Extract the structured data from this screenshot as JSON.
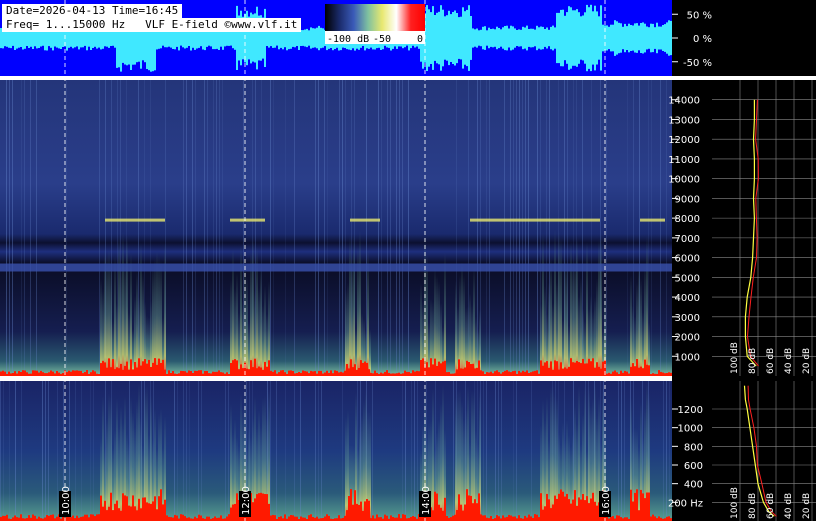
{
  "header": {
    "line1": "Date=2026-04-13 Time=16:45",
    "line2": "Freq= 1...15000 Hz   VLF E-field ©www.vlf.it"
  },
  "colorbar": {
    "labels": [
      "-100 dB",
      "-50",
      "0"
    ],
    "stops": [
      "#000000",
      "#1a2a6a",
      "#3a5ab8",
      "#7ec0a0",
      "#e8e870",
      "#ffffff",
      "#ff2020",
      "#ff0000"
    ]
  },
  "colors": {
    "waveform_bg": "#0000ff",
    "waveform_fg": "#40e8ff",
    "spec_dark": "#0a0f2a",
    "spec_mid": "#1e3278",
    "spec_bright": "#ff1a00",
    "grid": "#ffffff",
    "panel_bg": "#000000",
    "trace_yellow": "#ffff40",
    "trace_red": "#ff2020"
  },
  "chart_data": [
    {
      "type": "area",
      "panel": "waveform",
      "y_tick_labels": [
        "50 %",
        "0 %",
        "-50 %"
      ],
      "y_values": [
        50,
        0,
        -50
      ],
      "ylim": [
        -80,
        80
      ]
    },
    {
      "type": "heatmap",
      "panel": "spectrogram-full",
      "y_tick_labels": [
        "14000",
        "13000",
        "12000",
        "11000",
        "10000",
        "9000",
        "8000",
        "7000",
        "6000",
        "5000",
        "4000",
        "3000",
        "2000",
        "1000"
      ],
      "y_values": [
        14000,
        13000,
        12000,
        11000,
        10000,
        9000,
        8000,
        7000,
        6000,
        5000,
        4000,
        3000,
        2000,
        1000
      ],
      "ylim": [
        0,
        15000
      ],
      "x_time_marks": [
        "10:00",
        "12:00",
        "14:00",
        "16:00"
      ],
      "grid": true
    },
    {
      "type": "heatmap",
      "panel": "spectrogram-low",
      "y_tick_labels": [
        "1200",
        "1000",
        "800",
        "600",
        "400",
        "200 Hz"
      ],
      "y_values": [
        1200,
        1000,
        800,
        600,
        400,
        200
      ],
      "ylim": [
        0,
        1500
      ],
      "x_time_marks": [
        "10:00",
        "12:00",
        "14:00",
        "16:00"
      ],
      "grid": true
    },
    {
      "type": "line",
      "panel": "spectrum-full",
      "x_tick_labels": [
        "100 dB",
        "80 dB",
        "60 dB",
        "40 dB",
        "20 dB"
      ],
      "x_values": [
        -100,
        -80,
        -60,
        -40,
        -20
      ],
      "y_values": [
        14000,
        13000,
        12000,
        11000,
        10000,
        9000,
        8000,
        7000,
        6000,
        5000,
        4000,
        3000,
        2000,
        1000,
        500
      ],
      "avg_db": [
        -84,
        -84,
        -85,
        -84,
        -84,
        -85,
        -84,
        -85,
        -86,
        -88,
        -92,
        -94,
        -94,
        -92,
        -82
      ],
      "ylim": [
        0,
        15000
      ]
    },
    {
      "type": "line",
      "panel": "spectrum-low",
      "x_tick_labels": [
        "100 dB",
        "80 dB",
        "60 dB",
        "40 dB",
        "20 dB"
      ],
      "x_values": [
        -100,
        -80,
        -60,
        -40,
        -20
      ],
      "y_values": [
        1450,
        1300,
        1200,
        1000,
        800,
        600,
        400,
        200,
        100,
        50
      ],
      "avg_db": [
        -95,
        -94,
        -92,
        -89,
        -86,
        -83,
        -80,
        -74,
        -68,
        -62
      ],
      "ylim": [
        0,
        1500
      ]
    }
  ]
}
